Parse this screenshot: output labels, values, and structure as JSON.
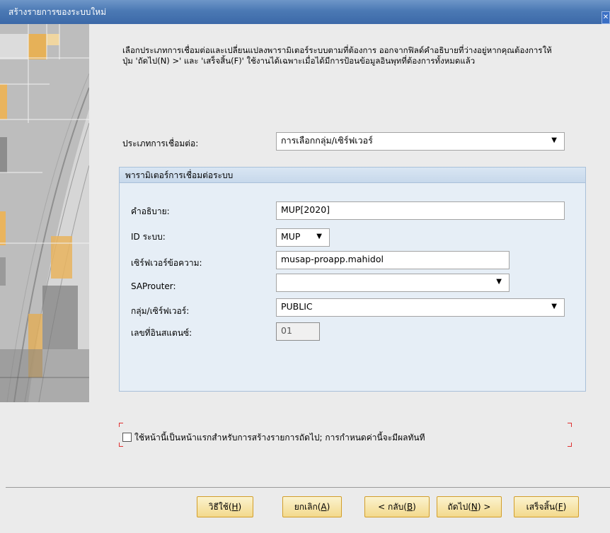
{
  "window": {
    "title": "สร้างรายการของระบบใหม่",
    "close_glyph": "✕"
  },
  "instructions": {
    "line1": "เลือกประเภทการเชื่อมต่อและเปลี่ยนแปลงพารามิเตอร์ระบบตามที่ต้องการ ออกจากฟิลด์คำอธิบายที่ว่างอยู่หากคุณต้องการให้",
    "line2": "ปุ่ม 'ถัดไป(N) >' และ 'เสร็จสิ้น(F)' ใช้งานได้เฉพาะเมื่อได้มีการป้อนข้อมูลอินพุทที่ต้องการทั้งหมดแล้ว"
  },
  "connection_type": {
    "label": "ประเภทการเชื่อมต่อ:",
    "value": "การเลือกกลุ่ม/เซิร์ฟเวอร์",
    "dropdown_icon": "chevron-down-icon"
  },
  "params": {
    "heading": "พารามิเตอร์การเชื่อมต่อระบบ",
    "description": {
      "label": "คำอธิบาย:",
      "value": "MUP[2020]"
    },
    "system_id": {
      "label": "ID ระบบ:",
      "value": "MUP"
    },
    "message_server": {
      "label": "เซิร์ฟเวอร์ข้อความ:",
      "value": "musap-proapp.mahidol"
    },
    "saprouter": {
      "label": "SAProuter:",
      "value": ""
    },
    "group_server": {
      "label": "กลุ่ม/เซิร์ฟเวอร์:",
      "value": "PUBLIC"
    },
    "instance_no": {
      "label": "เลขที่อินสแตนซ์:",
      "value": "01"
    }
  },
  "first_page_option": {
    "label": "ใช้หน้านี้เป็นหน้าแรกสำหรับการสร้างรายการถัดไป; การกำหนดค่านี้จะมีผลทันที",
    "checked": false
  },
  "buttons": {
    "help": {
      "text": "วิธีใช้(",
      "key": "H",
      "end": ")"
    },
    "cancel": {
      "text": "ยกเลิก(",
      "key": "A",
      "end": ")"
    },
    "back": {
      "text": "< กลับ(",
      "key": "B",
      "end": ")"
    },
    "next": {
      "text": "ถัดไป(",
      "key": "N",
      "end": ") >"
    },
    "finish": {
      "text": "เสร็จสิ้น(",
      "key": "F",
      "end": ")"
    }
  },
  "colors": {
    "title_bar": "#4b79b4",
    "button_fill": "#f3d98c",
    "button_border": "#d29e2a",
    "group_fill": "#e6eef6"
  }
}
